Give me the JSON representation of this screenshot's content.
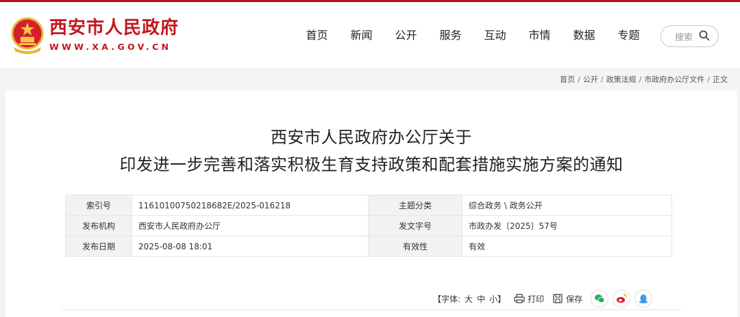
{
  "header": {
    "logo_title": "西安市人民政府",
    "logo_url": "WWW.XA.GOV.CN",
    "brand_color": "#c4161c"
  },
  "nav": {
    "items": [
      "首页",
      "新闻",
      "公开",
      "服务",
      "互动",
      "市情",
      "数据",
      "专题"
    ]
  },
  "search": {
    "placeholder": "搜索"
  },
  "breadcrumb": {
    "items": [
      "首页",
      "公开",
      "政策法规",
      "市政府办公厅文件",
      "正文"
    ],
    "separator": "/"
  },
  "document": {
    "title_line1": "西安市人民政府办公厅关于",
    "title_line2": "印发进一步完善和落实积极生育支持政策和配套措施实施方案的通知"
  },
  "meta": {
    "index_label": "索引号",
    "index_value": "11610100750218682E/2025-016218",
    "topic_label": "主题分类",
    "topic_value": "综合政务 \\ 政务公开",
    "issuer_label": "发布机构",
    "issuer_value": "西安市人民政府办公厅",
    "docno_label": "发文字号",
    "docno_value": "市政办发〔2025〕57号",
    "date_label": "发布日期",
    "date_value": "2025-08-08 18:01",
    "validity_label": "有效性",
    "validity_value": "有效"
  },
  "tools": {
    "font_label": "【字体:",
    "font_large": "大",
    "font_medium": "中",
    "font_small": "小】",
    "print_label": "打印",
    "save_label": "保存",
    "share_icons": [
      "wechat-icon",
      "weibo-icon",
      "qq-icon"
    ]
  }
}
